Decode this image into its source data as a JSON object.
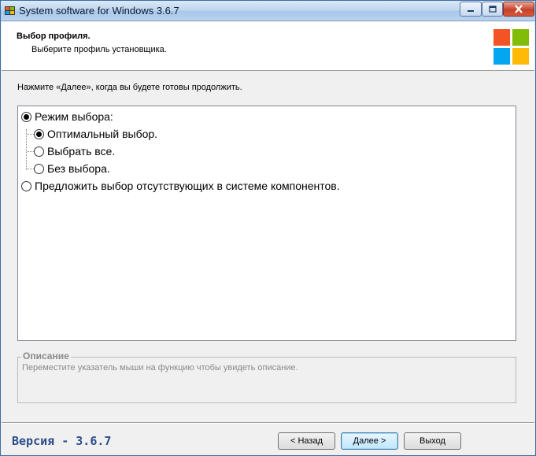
{
  "window": {
    "title": "System software for Windows 3.6.7",
    "icon": "app-icon",
    "controls": [
      "minimize-icon",
      "maximize-icon",
      "close-icon"
    ]
  },
  "header": {
    "title": "Выбор профиля.",
    "subtitle": "Выберите профиль установщика.",
    "logo": "windows-logo"
  },
  "hint": "Нажмите «Далее», когда вы будете готовы продолжить.",
  "profiles": {
    "mode": {
      "label": "Режим выбора:",
      "selected": true
    },
    "children": [
      {
        "label": "Оптимальный выбор.",
        "selected": true
      },
      {
        "label": "Выбрать все.",
        "selected": false
      },
      {
        "label": "Без выбора.",
        "selected": false
      }
    ],
    "missing": {
      "label": "Предложить выбор отсутствующих в системе компонентов.",
      "selected": false
    }
  },
  "description": {
    "legend": "Описание",
    "text": "Переместите указатель мыши на функцию чтобы увидеть описание."
  },
  "footer": {
    "version": "Версия - 3.6.7",
    "back": "< Назад",
    "next": "Далее >",
    "exit": "Выход"
  },
  "colors": {
    "logo_red": "#f35325",
    "logo_green": "#81bc06",
    "logo_blue": "#05a6f0",
    "logo_yellow": "#ffba08",
    "version_text": "#2d4e8a"
  }
}
